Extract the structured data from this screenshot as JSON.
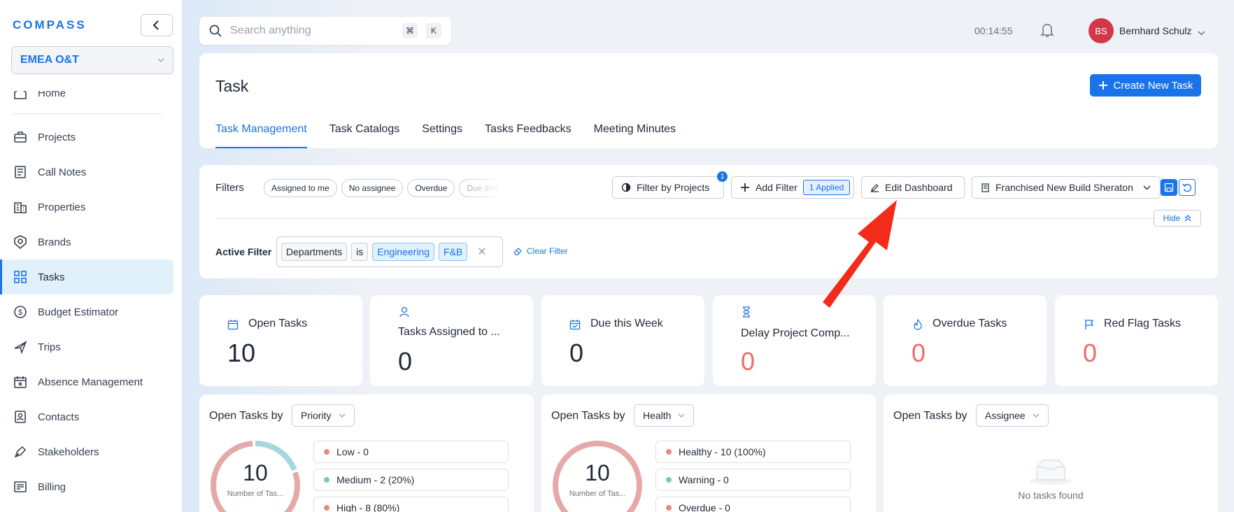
{
  "app": {
    "logo": "COMPASS",
    "org": "EMEA O&T"
  },
  "sidebar": {
    "partial_item": {
      "label": "Home",
      "icon": "home-icon"
    },
    "items": [
      {
        "label": "Projects",
        "icon": "briefcase-icon",
        "active": false
      },
      {
        "label": "Call Notes",
        "icon": "notes-icon",
        "active": false
      },
      {
        "label": "Properties",
        "icon": "building-icon",
        "active": false
      },
      {
        "label": "Brands",
        "icon": "brand-icon",
        "active": false
      },
      {
        "label": "Tasks",
        "icon": "grid-icon",
        "active": true
      },
      {
        "label": "Budget Estimator",
        "icon": "dollar-icon",
        "active": false
      },
      {
        "label": "Trips",
        "icon": "plane-icon",
        "active": false
      },
      {
        "label": "Absence Management",
        "icon": "calendar-x-icon",
        "active": false
      },
      {
        "label": "Contacts",
        "icon": "contact-icon",
        "active": false
      },
      {
        "label": "Stakeholders",
        "icon": "pen-icon",
        "active": false
      },
      {
        "label": "Billing",
        "icon": "billing-icon",
        "active": false
      }
    ]
  },
  "topbar": {
    "search_placeholder": "Search anything",
    "shortcut_cmd": "⌘",
    "shortcut_key": "K",
    "timer": "00:14:55",
    "user_initials": "BS",
    "user_name": "Bernhard Schulz"
  },
  "header": {
    "title": "Task",
    "create_button": "Create New Task",
    "tabs": [
      "Task Management",
      "Task Catalogs",
      "Settings",
      "Tasks Feedbacks",
      "Meeting Minutes"
    ],
    "active_tab": "Task Management"
  },
  "filters": {
    "label": "Filters",
    "chips": [
      "Assigned to me",
      "No assignee",
      "Overdue",
      "Due this"
    ],
    "filter_by_projects": "Filter by Projects",
    "filter_by_projects_count": "1",
    "add_filter": "Add Filter",
    "applied": "1 Applied",
    "edit_dashboard": "Edit Dashboard",
    "dashboard_select": "Franchised New Build Sheraton",
    "hide": "Hide",
    "active_label": "Active Filter",
    "active_field": "Departments",
    "active_op": "is",
    "active_values": [
      "Engineering",
      "F&B"
    ],
    "clear_filter": "Clear Filter"
  },
  "stats": [
    {
      "title": "Open Tasks",
      "value": "10",
      "icon": "calendar-icon",
      "red": false
    },
    {
      "title": "Tasks Assigned to ...",
      "value": "0",
      "icon": "user-icon",
      "red": false
    },
    {
      "title": "Due this Week",
      "value": "0",
      "icon": "calendar-check-icon",
      "red": false
    },
    {
      "title": "Delay Project Comp...",
      "value": "0",
      "icon": "hourglass-icon",
      "red": true
    },
    {
      "title": "Overdue Tasks",
      "value": "0",
      "icon": "fire-icon",
      "red": true
    },
    {
      "title": "Red Flag Tasks",
      "value": "0",
      "icon": "flag-icon",
      "red": true
    }
  ],
  "panels": [
    {
      "title": "Open Tasks by",
      "select": "Priority",
      "donut_value": "10",
      "donut_label": "Number of Tas...",
      "legend": [
        {
          "label": "Low - 0",
          "color": "#e28a8a"
        },
        {
          "label": "Medium - 2 (20%)",
          "color": "#7ec4c4"
        },
        {
          "label": "High - 8 (80%)",
          "color": "#e28a8a"
        }
      ],
      "segments": [
        {
          "fraction": 0.2,
          "color": "#a6d7db"
        },
        {
          "fraction": 0.8,
          "color": "#e6a9a9"
        }
      ]
    },
    {
      "title": "Open Tasks by",
      "select": "Health",
      "donut_value": "10",
      "donut_label": "Number of Tas...",
      "legend": [
        {
          "label": "Healthy - 10 (100%)",
          "color": "#e28a8a"
        },
        {
          "label": "Warning - 0",
          "color": "#7ec4c4"
        },
        {
          "label": "Overdue - 0",
          "color": "#e28a8a"
        }
      ],
      "segments": [
        {
          "fraction": 1.0,
          "color": "#e6a9a9"
        }
      ]
    },
    {
      "title": "Open Tasks by",
      "select": "Assignee",
      "empty_text": "No tasks found"
    }
  ],
  "colors": {
    "accent": "#1a73e8",
    "danger": "#ef6a6a",
    "arrow": "#f22b1a"
  }
}
